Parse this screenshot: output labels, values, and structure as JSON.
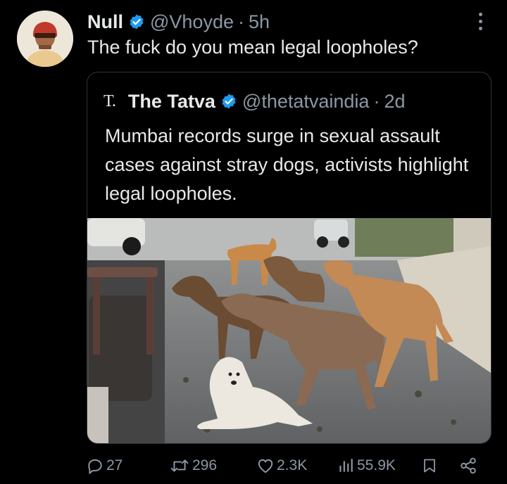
{
  "tweet": {
    "author_name": "Null",
    "author_handle": "@Vhoyde",
    "separator": "·",
    "time": "5h",
    "text": "The fuck do you mean legal loopholes?"
  },
  "quoted": {
    "logo_text": "T.",
    "author_name": "The Tatva",
    "author_handle": "@thetatvaindia",
    "separator": "·",
    "time": "2d",
    "text": "Mumbai records surge in sexual assault cases against stray dogs, activists highlight legal loopholes."
  },
  "actions": {
    "replies": "27",
    "retweets": "296",
    "likes": "2.3K",
    "views": "55.9K"
  },
  "colors": {
    "verified": "#1d9bf0",
    "muted": "#8b98a5",
    "text": "#e7e9ea",
    "border": "#2f3336"
  },
  "icons": [
    "verified-badge-icon",
    "more-icon",
    "reply-icon",
    "retweet-icon",
    "like-icon",
    "views-icon",
    "bookmark-icon",
    "share-icon"
  ]
}
